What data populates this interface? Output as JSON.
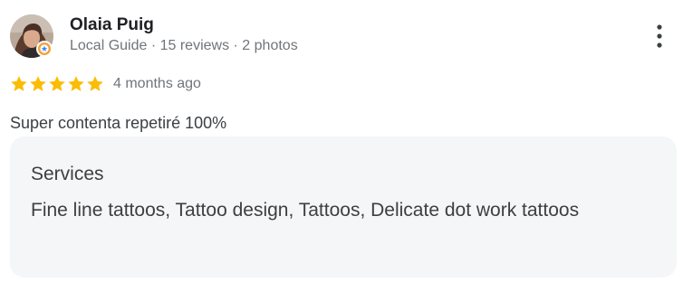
{
  "author": {
    "name": "Olaia Puig",
    "meta": "Local Guide · 15 reviews · 2 photos",
    "avatar_icon": "profile-photo",
    "badge_icon": "local-guide-badge-icon"
  },
  "more_menu": {
    "icon": "more-vert-icon"
  },
  "rating": {
    "stars": 5,
    "max_stars": 5,
    "star_color": "#fbbc04",
    "date": "4 months ago"
  },
  "review": {
    "text": "Super contenta repetiré 100%"
  },
  "services": {
    "title": "Services",
    "list": "Fine line tattoos, Tattoo design, Tattoos, Delicate dot work tattoos"
  },
  "colors": {
    "card_background": "#f5f6f8",
    "secondary_text": "#70757a",
    "primary_text": "#202124"
  }
}
